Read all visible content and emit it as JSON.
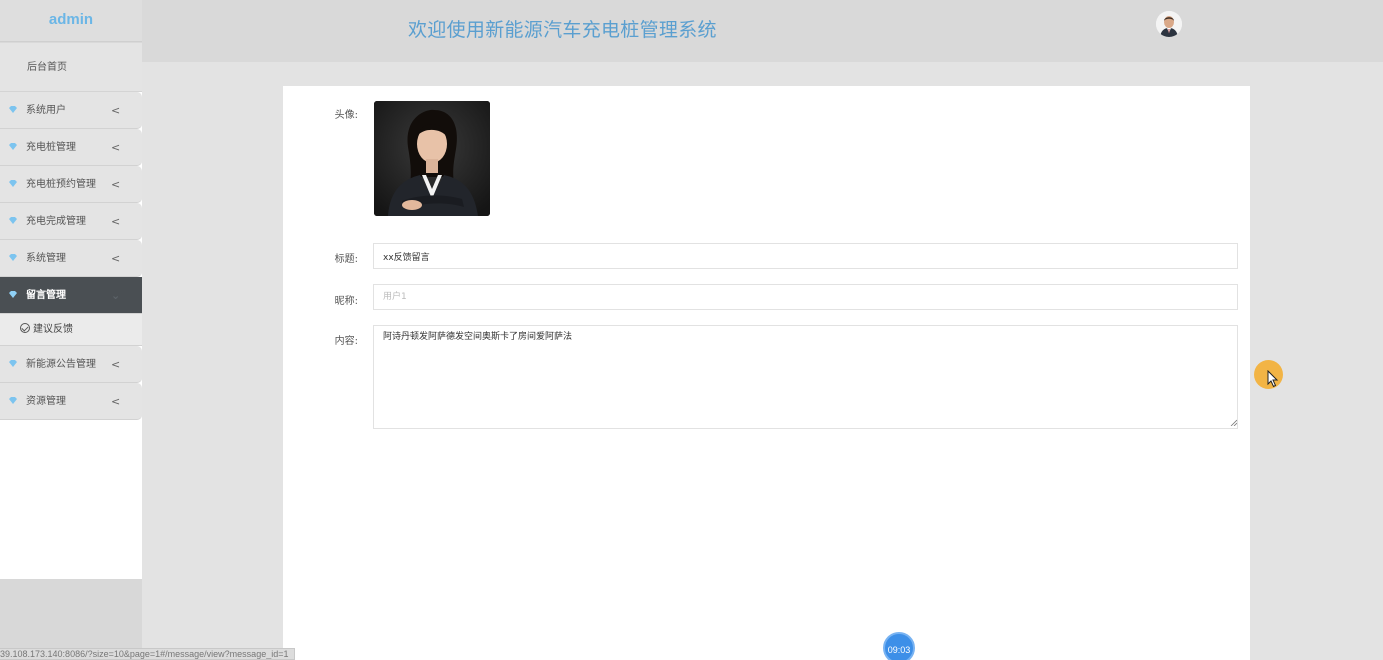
{
  "sidebar": {
    "brand": "admin",
    "home": "后台首页",
    "items": [
      {
        "label": "系统用户",
        "chevron": "<"
      },
      {
        "label": "充电桩管理",
        "chevron": "<"
      },
      {
        "label": "充电桩预约管理",
        "chevron": "<"
      },
      {
        "label": "充电完成管理",
        "chevron": "<"
      },
      {
        "label": "系统管理",
        "chevron": "<"
      },
      {
        "label": "留言管理",
        "chevron": "⌄",
        "active": true
      },
      {
        "label": "新能源公告管理",
        "chevron": "<"
      },
      {
        "label": "资源管理",
        "chevron": "<"
      }
    ],
    "subitem": "建议反馈"
  },
  "header": {
    "title": "欢迎使用新能源汽车充电桩管理系统"
  },
  "form": {
    "avatar_label": "头像:",
    "title_label": "标题:",
    "title_value": "xx反馈留言",
    "nickname_label": "昵称:",
    "nickname_placeholder": "用户1",
    "content_label": "内容:",
    "content_value": "阿诗丹顿发阿萨德发空间奥斯卡了房间爱阿萨法"
  },
  "overlay": {
    "timer": "09:03",
    "status_url": "39.108.173.140:8086/?size=10&page=1#/message/view?message_id=1"
  },
  "colors": {
    "accent": "#5a9fd0",
    "brand": "#6bb6e6",
    "active_nav": "#4a4f53",
    "diamond": "#7cc4ef"
  }
}
